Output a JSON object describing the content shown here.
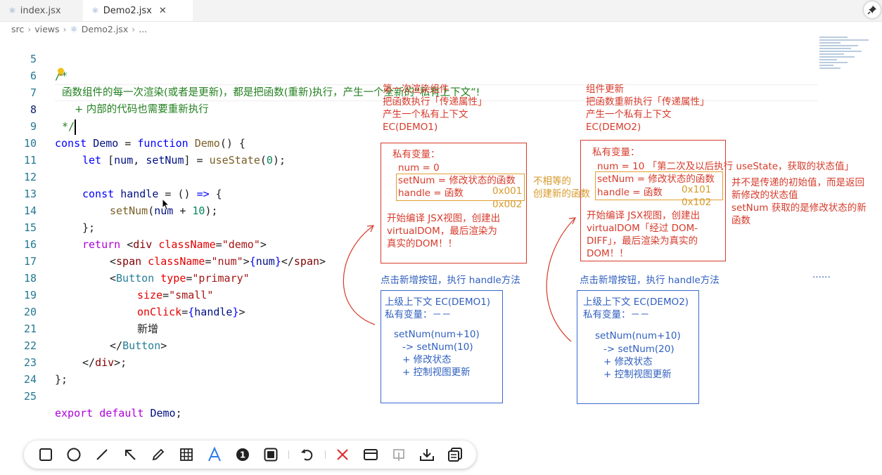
{
  "tabs": [
    {
      "label": "index.jsx",
      "active": false
    },
    {
      "label": "Demo2.jsx",
      "active": true,
      "close": "✕"
    }
  ],
  "breadcrumb": {
    "src": "src",
    "views": "views",
    "file": "Demo2.jsx",
    "more": "..."
  },
  "code": {
    "line_numbers": [
      "5",
      "6",
      "7",
      "8",
      "9",
      "10",
      "11",
      "12",
      "13",
      "14",
      "15",
      "16",
      "17",
      "18",
      "19",
      "20",
      "21",
      "22",
      "23",
      "24",
      "25"
    ],
    "l5": "/*",
    "l6": "函数组件的每一次渲染(或者是更新)，都是把函数(重新)执行，产生一个全新的“私有上下文”!",
    "l7": "+ 内部的代码也需要重新执行",
    "l8": "*/",
    "l9": {
      "k1": "const",
      "name": "Demo",
      "eq": " = ",
      "k2": "function",
      "fname": "Demo",
      "rest": "() {"
    },
    "l10": {
      "k": "let",
      "open": " [",
      "a": "num",
      "comma": ", ",
      "b": "setNum",
      "close": "] = ",
      "fn": "useState",
      "p1": "(",
      "n": "0",
      "p2": ");"
    },
    "l12": {
      "k": "const",
      "v": "handle",
      "rest": " = () ",
      "arrow": "=>",
      "brace": " {"
    },
    "l13": {
      "fn": "setNum",
      "p1": "(",
      "v": "num",
      "plus": " + ",
      "n": "10",
      "p2": ");"
    },
    "l14": "};",
    "l15": {
      "k": "return",
      "lt": " <",
      "tag": "div",
      "attr": " className",
      "eq": "=",
      "val": "\"demo\"",
      "gt": ">"
    },
    "l16": {
      "lt": "<",
      "tag": "span",
      "attr": " className",
      "eq": "=",
      "val": "\"num\"",
      "gt": ">",
      "b1": "{",
      "v": "num",
      "b2": "}",
      "lt2": "</",
      "tag2": "span",
      "gt2": ">"
    },
    "l17": {
      "lt": "<",
      "tag": "Button",
      "attr": " type",
      "eq": "=",
      "val": "\"primary\""
    },
    "l18": {
      "attr": "size",
      "eq": "=",
      "val": "\"small\""
    },
    "l19": {
      "attr": "onClick",
      "eq": "=",
      "b1": "{",
      "v": "handle",
      "b2": "}",
      "gt": ">"
    },
    "l20": "新增",
    "l21": {
      "lt": "</",
      "tag": "Button",
      "gt": ">"
    },
    "l22": {
      "lt": "</",
      "tag": "div",
      "gt": ">;"
    },
    "l23": "};",
    "l25": {
      "k1": "export",
      "k2": " default",
      "v": " Demo",
      "semi": ";"
    }
  },
  "annotations": {
    "first_title": [
      "第一次渲染组件",
      "把函数执行「传递属性」",
      "产生一个私有上下文",
      "EC(DEMO1)"
    ],
    "first_box": {
      "heading": "私有变量：",
      "num": "num = 0",
      "setnum": "setNum = 修改状态的函数",
      "handle": "handle = 函数",
      "addr1": "0x001",
      "addr2": "0x002",
      "desc": [
        "开始编译 JSX视图，创建出",
        "virtualDOM，最后渲染为",
        "真实的DOM！！"
      ]
    },
    "middle": [
      "不相等的",
      "创建新的函数"
    ],
    "second_title": [
      "组件更新",
      "把函数重新执行「传递属性」",
      "产生一个私有上下文",
      "EC(DEMO2)"
    ],
    "second_box": {
      "heading": "私有变量：",
      "num": "num = 10 「第二次及以后执行 useState，获取的状态值」",
      "setnum": "setNum = 修改状态的函数",
      "handle": "handle = 函数",
      "addr1": "0x101",
      "addr2": "0x102",
      "desc": [
        "开始编译 JSX视图，创建出",
        "virtualDOM「经过 DOM-",
        "DIFF」，最后渲染为真实的",
        "DOM！！"
      ]
    },
    "side_note": [
      "并不是传递的初始值，而是返回",
      "新修改的状态值",
      "setNum 获取的是修改状态的新",
      "函数"
    ],
    "click1": "点击新增按钮，执行 handle方法",
    "click2": "点击新增按钮，执行 handle方法",
    "ellipsis": "......",
    "blue1": {
      "l1": "上级上下文 EC(DEMO1)",
      "l2": "私有变量：－－",
      "l3": "setNum(num+10)",
      "l4": "-> setNum(10)",
      "l5": "+ 修改状态",
      "l6": "+ 控制视图更新"
    },
    "blue2": {
      "l1": "上级上下文 EC(DEMO2)",
      "l2": "私有变量：－－",
      "l3": "setNum(num+10)",
      "l4": "-> setNum(20)",
      "l5": "+ 修改状态",
      "l6": "+ 控制视图更新"
    }
  },
  "colors": {
    "red": "#d63a2a",
    "blue": "#2f5fbf",
    "orange": "#d69a2a",
    "active_tool": "#2b7de9"
  },
  "toolbar": {
    "tools": [
      "rectangle-tool",
      "ellipse-tool",
      "line-tool",
      "arrow-tool",
      "pen-tool",
      "mosaic-tool",
      "text-tool",
      "step-number-tool",
      "blur-tool",
      "undo-tool",
      "close-tool",
      "window-tool",
      "pin-tool",
      "download-tool",
      "copy-tool"
    ],
    "step_number": "1"
  }
}
